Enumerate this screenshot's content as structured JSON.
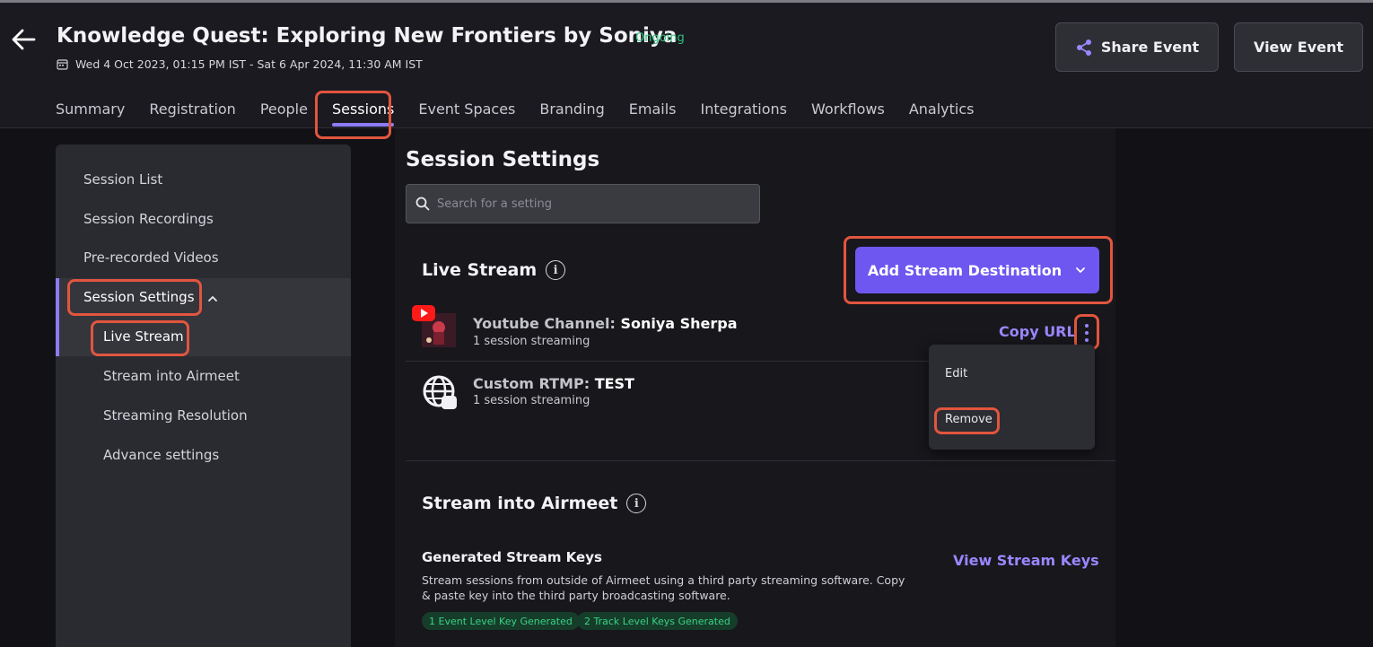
{
  "event": {
    "title": "Knowledge Quest: Exploring New Frontiers by Soniya",
    "status": "Ongoing",
    "date_range": "Wed 4 Oct 2023, 01:15 PM IST - Sat 6 Apr 2024, 11:30 AM IST"
  },
  "header_buttons": {
    "share": "Share Event",
    "view": "View Event"
  },
  "tabs": [
    "Summary",
    "Registration",
    "People",
    "Sessions",
    "Event Spaces",
    "Branding",
    "Emails",
    "Integrations",
    "Workflows",
    "Analytics"
  ],
  "active_tab": "Sessions",
  "sidebar": {
    "items": [
      "Session List",
      "Session Recordings",
      "Pre-recorded Videos",
      "Session Settings"
    ],
    "sub_items": [
      "Live Stream",
      "Stream into Airmeet",
      "Streaming Resolution",
      "Advance settings"
    ]
  },
  "main": {
    "title": "Session Settings",
    "search_placeholder": "Search for a setting",
    "live_stream": {
      "title": "Live Stream",
      "add_button": "Add Stream Destination",
      "destinations": [
        {
          "type": "Youtube Channel:",
          "name": "Soniya Sherpa",
          "sub": "1 session streaming"
        },
        {
          "type": "Custom RTMP:",
          "name": "TEST",
          "sub": "1 session streaming"
        }
      ],
      "copy_url": "Copy URL",
      "menu": {
        "edit": "Edit",
        "remove": "Remove"
      }
    },
    "stream_into": {
      "title": "Stream into Airmeet",
      "keys_title": "Generated Stream Keys",
      "keys_desc": "Stream sessions from outside of Airmeet using a third party streaming software. Copy & paste key into the third party broadcasting software.",
      "badges": [
        "1 Event Level Key Generated",
        "2 Track Level Keys Generated"
      ],
      "view_keys": "View Stream Keys"
    }
  },
  "colors": {
    "accent": "#6e57f0",
    "link": "#9b86ff",
    "highlight": "#e2553e",
    "success": "#2ec27e"
  }
}
